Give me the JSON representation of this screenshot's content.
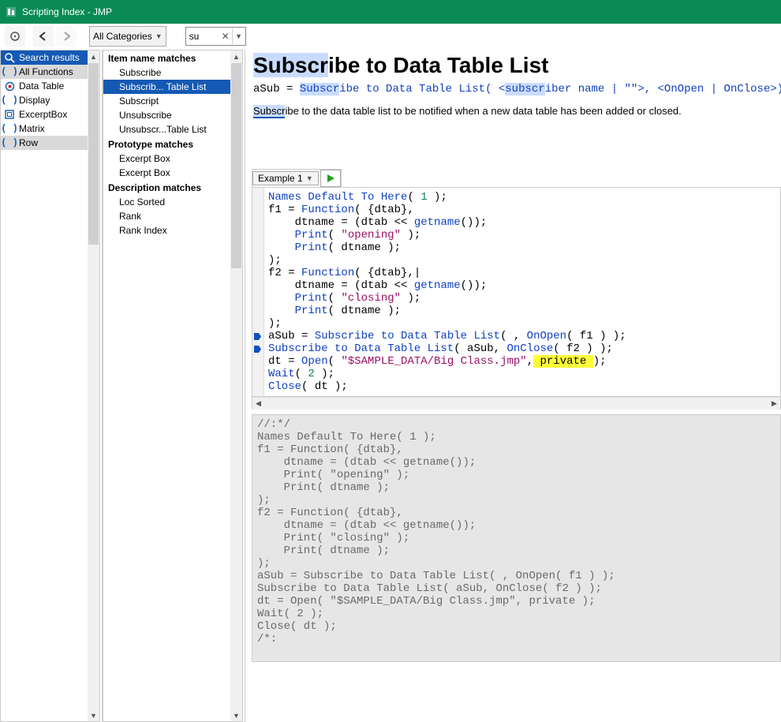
{
  "window": {
    "title": "Scripting Index - JMP"
  },
  "toolbar": {
    "category": "All Categories",
    "search_value": "su"
  },
  "sidebar": [
    {
      "label": "Search results",
      "icon": "magnifier-icon",
      "state": "sel",
      "color": "#1459b3"
    },
    {
      "label": "All Functions",
      "icon": "parens-icon",
      "state": "hl"
    },
    {
      "label": "Data Table",
      "icon": "target-icon",
      "state": ""
    },
    {
      "label": "Display",
      "icon": "parens-icon",
      "state": ""
    },
    {
      "label": "ExcerptBox",
      "icon": "square-icon",
      "state": ""
    },
    {
      "label": "Matrix",
      "icon": "parens-icon",
      "state": ""
    },
    {
      "label": "Row",
      "icon": "parens-icon",
      "state": "hl"
    }
  ],
  "middle": {
    "groups": [
      {
        "title": "Item name matches",
        "items": [
          {
            "label": "Subscribe"
          },
          {
            "label": "Subscrib... Table List",
            "selected": true
          },
          {
            "label": "Subscript"
          },
          {
            "label": "Unsubscribe"
          },
          {
            "label": "Unsubscr...Table List"
          }
        ]
      },
      {
        "title": "Prototype matches",
        "items": [
          {
            "label": "Excerpt Box"
          },
          {
            "label": "Excerpt Box"
          }
        ]
      },
      {
        "title": "Description matches",
        "items": [
          {
            "label": "Loc Sorted"
          },
          {
            "label": "Rank"
          },
          {
            "label": "Rank Index"
          }
        ]
      }
    ]
  },
  "detail": {
    "title_pre": "Subscr",
    "title_post": "ibe to Data Table List",
    "sig_parts": {
      "a": "aSub = ",
      "b": "Subscr",
      "c": "ibe to Data Table List( <",
      "d": "subscr",
      "e": "iber name | \"\">, <OnOpen | OnClose>)"
    },
    "desc_hl": "Subscr",
    "desc_rest": "ibe to the data table list to be notified when a new data table has been added or closed.",
    "example_label": "Example 1",
    "code_lines": [
      {
        "t": "plain",
        "s": "Names Default To Here( 1 );",
        "tokens": [
          [
            "fn",
            "Names Default To Here"
          ],
          [
            "",
            "( "
          ],
          [
            "num",
            "1"
          ],
          [
            "",
            " );"
          ]
        ]
      },
      {
        "t": "plain",
        "tokens": [
          [
            "",
            "f1 = "
          ],
          [
            "fn",
            "Function"
          ],
          [
            "",
            "( {dtab},"
          ]
        ]
      },
      {
        "t": "plain",
        "tokens": [
          [
            "",
            "    dtname = (dtab << "
          ],
          [
            "fn",
            "getname"
          ],
          [
            "",
            "());"
          ]
        ]
      },
      {
        "t": "plain",
        "tokens": [
          [
            "",
            "    "
          ],
          [
            "fn",
            "Print"
          ],
          [
            "",
            "( "
          ],
          [
            "str",
            "\"opening\""
          ],
          [
            "",
            " );"
          ]
        ]
      },
      {
        "t": "plain",
        "tokens": [
          [
            "",
            "    "
          ],
          [
            "fn",
            "Print"
          ],
          [
            "",
            "( dtname );"
          ]
        ]
      },
      {
        "t": "plain",
        "tokens": [
          [
            "",
            ");"
          ]
        ]
      },
      {
        "t": "plain",
        "tokens": [
          [
            "",
            "f2 = "
          ],
          [
            "fn",
            "Function"
          ],
          [
            "",
            "( {dtab},|"
          ]
        ]
      },
      {
        "t": "plain",
        "tokens": [
          [
            "",
            "    dtname = (dtab << "
          ],
          [
            "fn",
            "getname"
          ],
          [
            "",
            "());"
          ]
        ]
      },
      {
        "t": "plain",
        "tokens": [
          [
            "",
            "    "
          ],
          [
            "fn",
            "Print"
          ],
          [
            "",
            "( "
          ],
          [
            "str",
            "\"closing\""
          ],
          [
            "",
            " );"
          ]
        ]
      },
      {
        "t": "plain",
        "tokens": [
          [
            "",
            "    "
          ],
          [
            "fn",
            "Print"
          ],
          [
            "",
            "( dtname );"
          ]
        ]
      },
      {
        "t": "plain",
        "tokens": [
          [
            "",
            ");"
          ]
        ]
      },
      {
        "t": "bp",
        "tokens": [
          [
            "",
            "aSub = "
          ],
          [
            "fn",
            "Subscribe to Data Table List"
          ],
          [
            "",
            "( , "
          ],
          [
            "fn",
            "OnOpen"
          ],
          [
            "",
            "( f1 ) );"
          ]
        ]
      },
      {
        "t": "bp",
        "tokens": [
          [
            "fn",
            "Subscribe to Data Table List"
          ],
          [
            "",
            "( aSub, "
          ],
          [
            "fn",
            "OnClose"
          ],
          [
            "",
            "( f2 ) );"
          ]
        ]
      },
      {
        "t": "plain",
        "tokens": [
          [
            "",
            "dt = "
          ],
          [
            "fn",
            "Open"
          ],
          [
            "",
            "( "
          ],
          [
            "str",
            "\"$SAMPLE_DATA/Big Class.jmp\""
          ],
          [
            "",
            ","
          ],
          [
            "mark",
            " private "
          ],
          [
            "",
            ");"
          ]
        ]
      },
      {
        "t": "plain",
        "tokens": [
          [
            "fn",
            "Wait"
          ],
          [
            "",
            "( "
          ],
          [
            "num",
            "2"
          ],
          [
            "",
            " );"
          ]
        ]
      },
      {
        "t": "plain",
        "tokens": [
          [
            "fn",
            "Close"
          ],
          [
            "",
            "( dt );"
          ]
        ]
      }
    ],
    "gray_lines": [
      "//:*/",
      "Names Default To Here( 1 );",
      "f1 = Function( {dtab},",
      "    dtname = (dtab << getname());",
      "    Print( \"opening\" );",
      "    Print( dtname );",
      ");",
      "f2 = Function( {dtab},",
      "    dtname = (dtab << getname());",
      "    Print( \"closing\" );",
      "    Print( dtname );",
      ");",
      "aSub = Subscribe to Data Table List( , OnOpen( f1 ) );",
      "Subscribe to Data Table List( aSub, OnClose( f2 ) );",
      "dt = Open( \"$SAMPLE_DATA/Big Class.jmp\", private );",
      "Wait( 2 );",
      "Close( dt );",
      "/*:"
    ]
  }
}
